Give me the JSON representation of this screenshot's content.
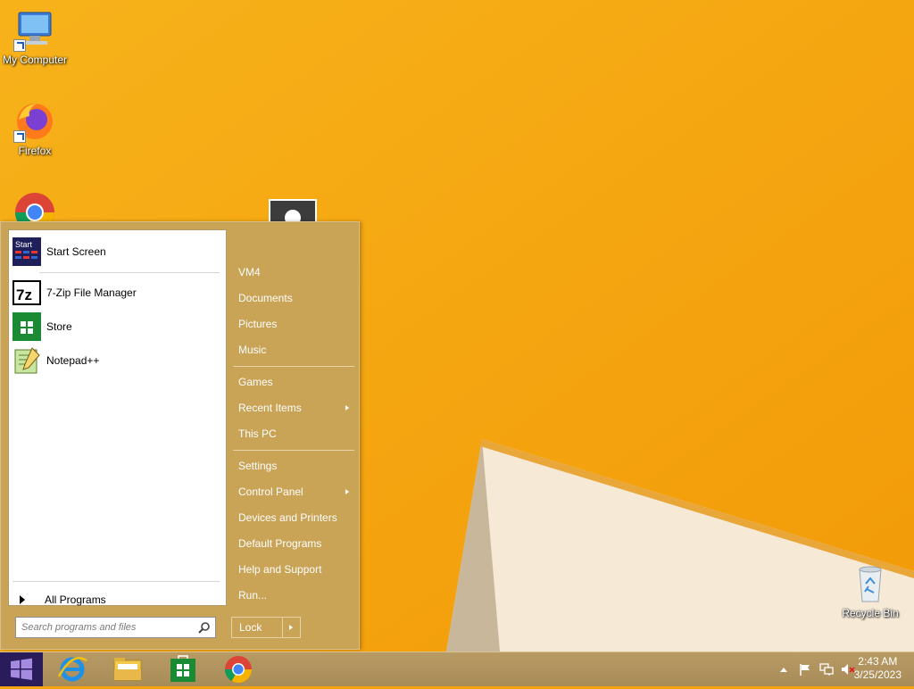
{
  "desktop": {
    "icons": [
      {
        "label": "My Computer"
      },
      {
        "label": "Firefox"
      },
      {
        "label": "Recycle Bin"
      }
    ]
  },
  "start_menu": {
    "programs": [
      {
        "label": "Start Screen",
        "icon": "start-screen-icon",
        "icon_text": "Start"
      },
      {
        "label": "7-Zip File Manager",
        "icon": "7zip-icon",
        "icon_text": "7z"
      },
      {
        "label": "Store",
        "icon": "store-icon"
      },
      {
        "label": "Notepad++",
        "icon": "notepad-plus-plus-icon"
      }
    ],
    "all_programs": "All Programs",
    "search_placeholder": "Search programs and files",
    "right_items": [
      {
        "label": "VM4"
      },
      {
        "label": "Documents"
      },
      {
        "label": "Pictures"
      },
      {
        "label": "Music"
      },
      {
        "label": "Games"
      },
      {
        "label": "Recent Items",
        "submenu": true
      },
      {
        "label": "This PC"
      },
      {
        "label": "Settings"
      },
      {
        "label": "Control Panel",
        "submenu": true
      },
      {
        "label": "Devices and Printers"
      },
      {
        "label": "Default Programs"
      },
      {
        "label": "Help and Support"
      },
      {
        "label": "Run..."
      }
    ],
    "lock_label": "Lock"
  },
  "taskbar": {
    "apps": [
      "internet-explorer-icon",
      "file-explorer-icon",
      "store-icon",
      "chrome-icon"
    ],
    "clock": {
      "time": "2:43 AM",
      "date": "3/25/2023"
    }
  },
  "colors": {
    "wallpaper": "#f4a40e",
    "menu_bg": "#c9a356",
    "taskbar": "#b0935e",
    "start_button": "#2a1b5a"
  }
}
